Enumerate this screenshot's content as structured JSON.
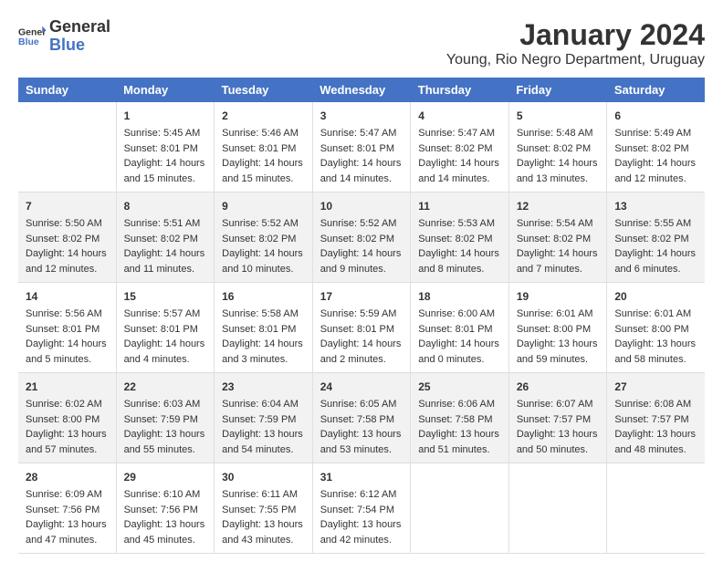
{
  "logo": {
    "line1": "General",
    "line2": "Blue"
  },
  "title": "January 2024",
  "subtitle": "Young, Rio Negro Department, Uruguay",
  "headers": [
    "Sunday",
    "Monday",
    "Tuesday",
    "Wednesday",
    "Thursday",
    "Friday",
    "Saturday"
  ],
  "weeks": [
    [
      {
        "day": "",
        "data": ""
      },
      {
        "day": "1",
        "data": "Sunrise: 5:45 AM\nSunset: 8:01 PM\nDaylight: 14 hours\nand 15 minutes."
      },
      {
        "day": "2",
        "data": "Sunrise: 5:46 AM\nSunset: 8:01 PM\nDaylight: 14 hours\nand 15 minutes."
      },
      {
        "day": "3",
        "data": "Sunrise: 5:47 AM\nSunset: 8:01 PM\nDaylight: 14 hours\nand 14 minutes."
      },
      {
        "day": "4",
        "data": "Sunrise: 5:47 AM\nSunset: 8:02 PM\nDaylight: 14 hours\nand 14 minutes."
      },
      {
        "day": "5",
        "data": "Sunrise: 5:48 AM\nSunset: 8:02 PM\nDaylight: 14 hours\nand 13 minutes."
      },
      {
        "day": "6",
        "data": "Sunrise: 5:49 AM\nSunset: 8:02 PM\nDaylight: 14 hours\nand 12 minutes."
      }
    ],
    [
      {
        "day": "7",
        "data": "Sunrise: 5:50 AM\nSunset: 8:02 PM\nDaylight: 14 hours\nand 12 minutes."
      },
      {
        "day": "8",
        "data": "Sunrise: 5:51 AM\nSunset: 8:02 PM\nDaylight: 14 hours\nand 11 minutes."
      },
      {
        "day": "9",
        "data": "Sunrise: 5:52 AM\nSunset: 8:02 PM\nDaylight: 14 hours\nand 10 minutes."
      },
      {
        "day": "10",
        "data": "Sunrise: 5:52 AM\nSunset: 8:02 PM\nDaylight: 14 hours\nand 9 minutes."
      },
      {
        "day": "11",
        "data": "Sunrise: 5:53 AM\nSunset: 8:02 PM\nDaylight: 14 hours\nand 8 minutes."
      },
      {
        "day": "12",
        "data": "Sunrise: 5:54 AM\nSunset: 8:02 PM\nDaylight: 14 hours\nand 7 minutes."
      },
      {
        "day": "13",
        "data": "Sunrise: 5:55 AM\nSunset: 8:02 PM\nDaylight: 14 hours\nand 6 minutes."
      }
    ],
    [
      {
        "day": "14",
        "data": "Sunrise: 5:56 AM\nSunset: 8:01 PM\nDaylight: 14 hours\nand 5 minutes."
      },
      {
        "day": "15",
        "data": "Sunrise: 5:57 AM\nSunset: 8:01 PM\nDaylight: 14 hours\nand 4 minutes."
      },
      {
        "day": "16",
        "data": "Sunrise: 5:58 AM\nSunset: 8:01 PM\nDaylight: 14 hours\nand 3 minutes."
      },
      {
        "day": "17",
        "data": "Sunrise: 5:59 AM\nSunset: 8:01 PM\nDaylight: 14 hours\nand 2 minutes."
      },
      {
        "day": "18",
        "data": "Sunrise: 6:00 AM\nSunset: 8:01 PM\nDaylight: 14 hours\nand 0 minutes."
      },
      {
        "day": "19",
        "data": "Sunrise: 6:01 AM\nSunset: 8:00 PM\nDaylight: 13 hours\nand 59 minutes."
      },
      {
        "day": "20",
        "data": "Sunrise: 6:01 AM\nSunset: 8:00 PM\nDaylight: 13 hours\nand 58 minutes."
      }
    ],
    [
      {
        "day": "21",
        "data": "Sunrise: 6:02 AM\nSunset: 8:00 PM\nDaylight: 13 hours\nand 57 minutes."
      },
      {
        "day": "22",
        "data": "Sunrise: 6:03 AM\nSunset: 7:59 PM\nDaylight: 13 hours\nand 55 minutes."
      },
      {
        "day": "23",
        "data": "Sunrise: 6:04 AM\nSunset: 7:59 PM\nDaylight: 13 hours\nand 54 minutes."
      },
      {
        "day": "24",
        "data": "Sunrise: 6:05 AM\nSunset: 7:58 PM\nDaylight: 13 hours\nand 53 minutes."
      },
      {
        "day": "25",
        "data": "Sunrise: 6:06 AM\nSunset: 7:58 PM\nDaylight: 13 hours\nand 51 minutes."
      },
      {
        "day": "26",
        "data": "Sunrise: 6:07 AM\nSunset: 7:57 PM\nDaylight: 13 hours\nand 50 minutes."
      },
      {
        "day": "27",
        "data": "Sunrise: 6:08 AM\nSunset: 7:57 PM\nDaylight: 13 hours\nand 48 minutes."
      }
    ],
    [
      {
        "day": "28",
        "data": "Sunrise: 6:09 AM\nSunset: 7:56 PM\nDaylight: 13 hours\nand 47 minutes."
      },
      {
        "day": "29",
        "data": "Sunrise: 6:10 AM\nSunset: 7:56 PM\nDaylight: 13 hours\nand 45 minutes."
      },
      {
        "day": "30",
        "data": "Sunrise: 6:11 AM\nSunset: 7:55 PM\nDaylight: 13 hours\nand 43 minutes."
      },
      {
        "day": "31",
        "data": "Sunrise: 6:12 AM\nSunset: 7:54 PM\nDaylight: 13 hours\nand 42 minutes."
      },
      {
        "day": "",
        "data": ""
      },
      {
        "day": "",
        "data": ""
      },
      {
        "day": "",
        "data": ""
      }
    ]
  ]
}
